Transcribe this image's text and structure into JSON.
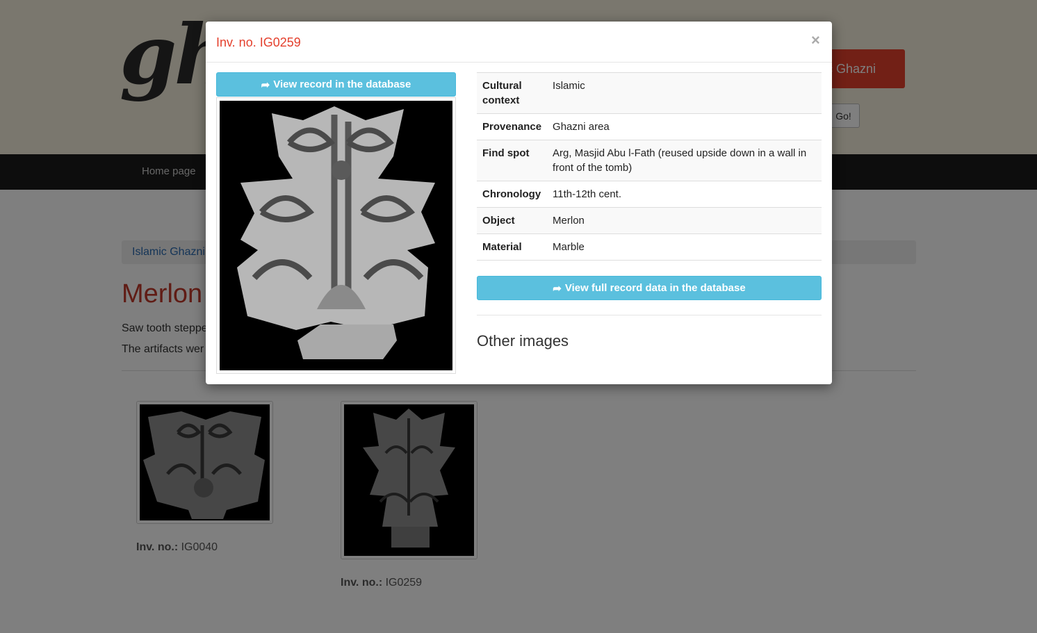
{
  "site": {
    "logo_text": "gh",
    "top_button_label": "c Ghazni",
    "go_label": "Go!",
    "nav": {
      "home_label": "Home page"
    },
    "breadcrumb_label": "Islamic Ghazni",
    "page_title": "Merlon",
    "description_line1": "Saw tooth steppe",
    "description_line2": "The artifacts wer",
    "thumbnails": [
      {
        "inv_label": "Inv. no.:",
        "inv_value": "IG0040"
      },
      {
        "inv_label": "Inv. no.:",
        "inv_value": "IG0259"
      }
    ]
  },
  "modal": {
    "title": "Inv. no. IG0259",
    "close_label": "×",
    "view_record_label": "View record in the database",
    "details": [
      {
        "key": "Cultural context",
        "value": "Islamic"
      },
      {
        "key": "Provenance",
        "value": "Ghazni area"
      },
      {
        "key": "Find spot",
        "value": "Arg, Masjid Abu l-Fath (reused upside down in a wall in front of the tomb)"
      },
      {
        "key": "Chronology",
        "value": "11th-12th cent."
      },
      {
        "key": "Object",
        "value": "Merlon"
      },
      {
        "key": "Material",
        "value": "Marble"
      }
    ],
    "view_full_label": "View full record data in the database",
    "other_images_heading": "Other images"
  },
  "colors": {
    "accent_red": "#e4402d",
    "info_button": "#5bc0de",
    "navbar": "#1a1a1a",
    "header_band": "#f4eedc",
    "link_blue": "#2a6ab0"
  },
  "icons": {
    "share": "share-arrow-icon",
    "close": "close-icon"
  }
}
